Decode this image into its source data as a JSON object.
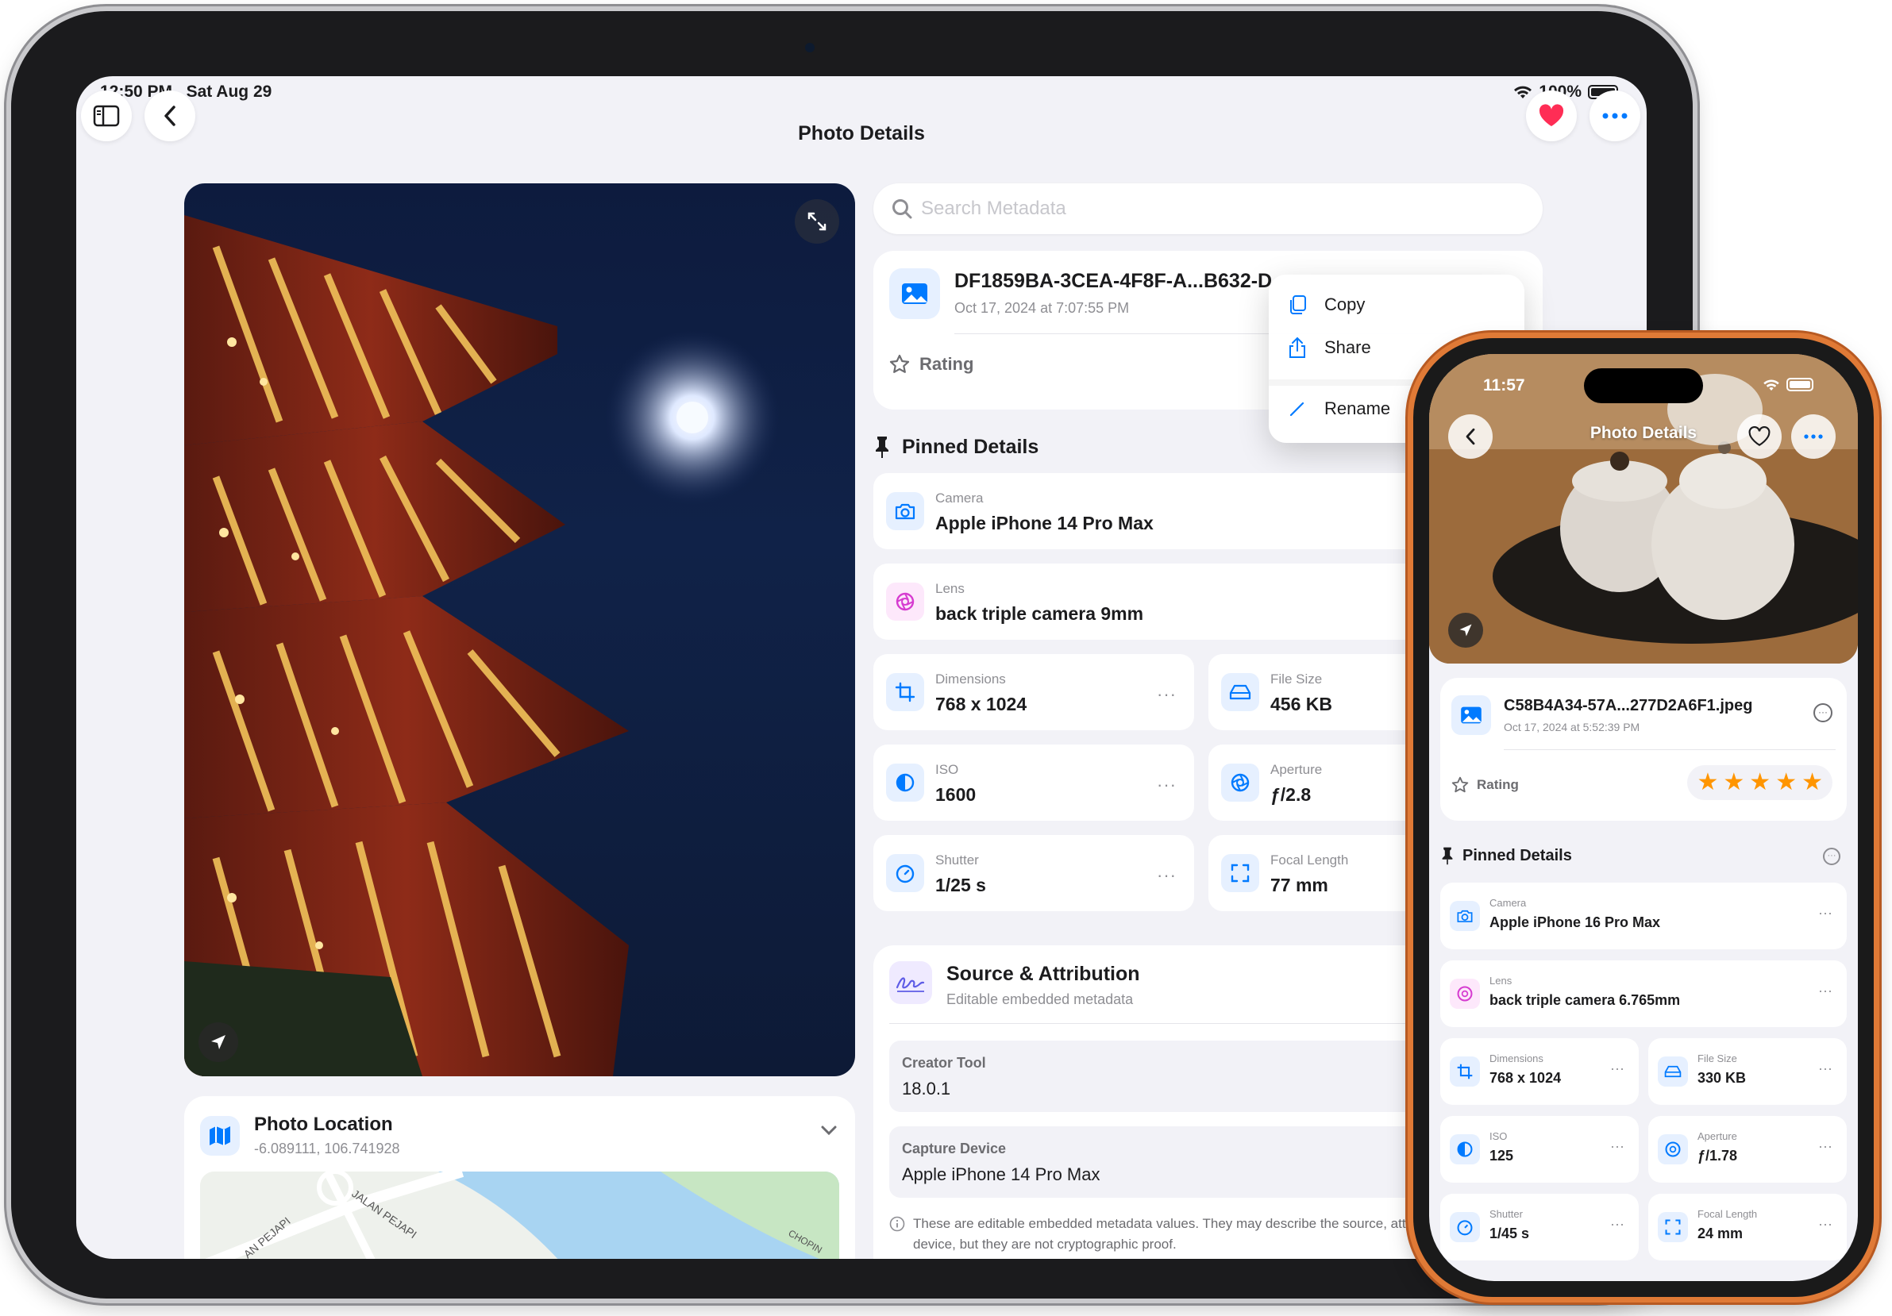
{
  "ipad": {
    "status": {
      "time": "12:50 PM",
      "date": "Sat Aug 29",
      "battery": "100%"
    },
    "nav": {
      "title": "Photo Details"
    },
    "search": {
      "placeholder": "Search Metadata"
    },
    "file": {
      "name": "DF1859BA-3CEA-4F8F-A...B632-D",
      "date": "Oct 17, 2024 at 7:07:55 PM",
      "rating_label": "Rating"
    },
    "context_menu": {
      "copy": "Copy",
      "share": "Share",
      "rename": "Rename"
    },
    "pinned": {
      "title": "Pinned Details",
      "camera": {
        "label": "Camera",
        "value": "Apple iPhone 14 Pro Max"
      },
      "lens": {
        "label": "Lens",
        "value": "back triple camera 9mm"
      },
      "dimensions": {
        "label": "Dimensions",
        "value": "768 x 1024"
      },
      "file_size": {
        "label": "File Size",
        "value": "456 KB"
      },
      "iso": {
        "label": "ISO",
        "value": "1600"
      },
      "aperture": {
        "label": "Aperture",
        "value": "ƒ/2.8"
      },
      "shutter": {
        "label": "Shutter",
        "value": "1/25 s"
      },
      "focal_length": {
        "label": "Focal Length",
        "value": "77 mm"
      },
      "more": "···"
    },
    "source": {
      "title": "Source & Attribution",
      "subtitle": "Editable embedded metadata",
      "creator_label": "Creator Tool",
      "creator_value": "18.0.1",
      "device_label": "Capture Device",
      "device_value": "Apple iPhone 14 Pro Max",
      "note": "These are editable embedded metadata values. They may describe the source, attribution, or capture device, but they are not cryptographic proof."
    },
    "location": {
      "title": "Photo Location",
      "coords": "-6.089111, 106.741928",
      "street1": "JALAN PEJAPI",
      "street2": "AN PEJAPI",
      "street3": "CHOPIN"
    }
  },
  "iphone": {
    "status": {
      "time": "11:57"
    },
    "nav": {
      "title": "Photo Details"
    },
    "file": {
      "name": "C58B4A34-57A...277D2A6F1.jpeg",
      "date": "Oct 17, 2024 at 5:52:39 PM",
      "rating_label": "Rating",
      "more": "···"
    },
    "rating": 5,
    "pinned": {
      "title": "Pinned Details",
      "more": "···",
      "camera": {
        "label": "Camera",
        "value": "Apple iPhone 16 Pro Max"
      },
      "lens": {
        "label": "Lens",
        "value": "back triple camera 6.765mm"
      },
      "dimensions": {
        "label": "Dimensions",
        "value": "768 x 1024"
      },
      "file_size": {
        "label": "File Size",
        "value": "330 KB"
      },
      "iso": {
        "label": "ISO",
        "value": "125"
      },
      "aperture": {
        "label": "Aperture",
        "value": "ƒ/1.78"
      },
      "shutter": {
        "label": "Shutter",
        "value": "1/45 s"
      },
      "focal_length": {
        "label": "Focal Length",
        "value": "24 mm"
      }
    }
  },
  "colors": {
    "accent": "#007aff",
    "heart": "#ff2d55",
    "star": "#ff9500",
    "frame_orange": "#e07a36"
  }
}
